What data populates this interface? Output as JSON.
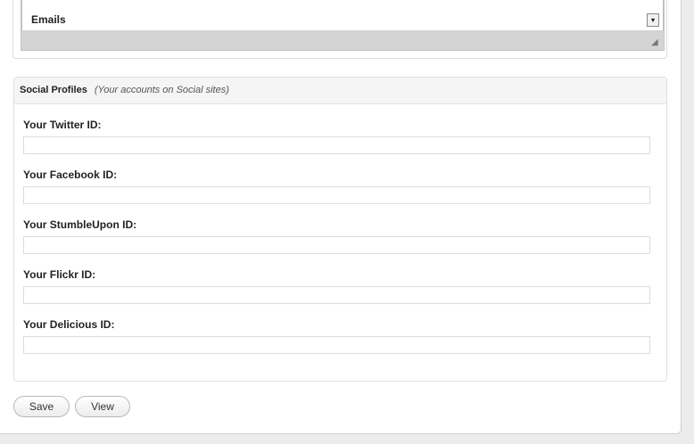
{
  "emails_section": {
    "label": "Emails",
    "scroll_glyph": "▾",
    "resize_glyph": "◢"
  },
  "social_profiles": {
    "title": "Social Profiles",
    "subtitle": "(Your accounts on Social sites)",
    "fields": [
      {
        "label": "Your Twitter ID:",
        "value": ""
      },
      {
        "label": "Your Facebook ID:",
        "value": ""
      },
      {
        "label": "Your StumbleUpon ID:",
        "value": ""
      },
      {
        "label": "Your Flickr ID:",
        "value": ""
      },
      {
        "label": "Your Delicious ID:",
        "value": ""
      }
    ]
  },
  "actions": {
    "save_label": "Save",
    "view_label": "View"
  }
}
